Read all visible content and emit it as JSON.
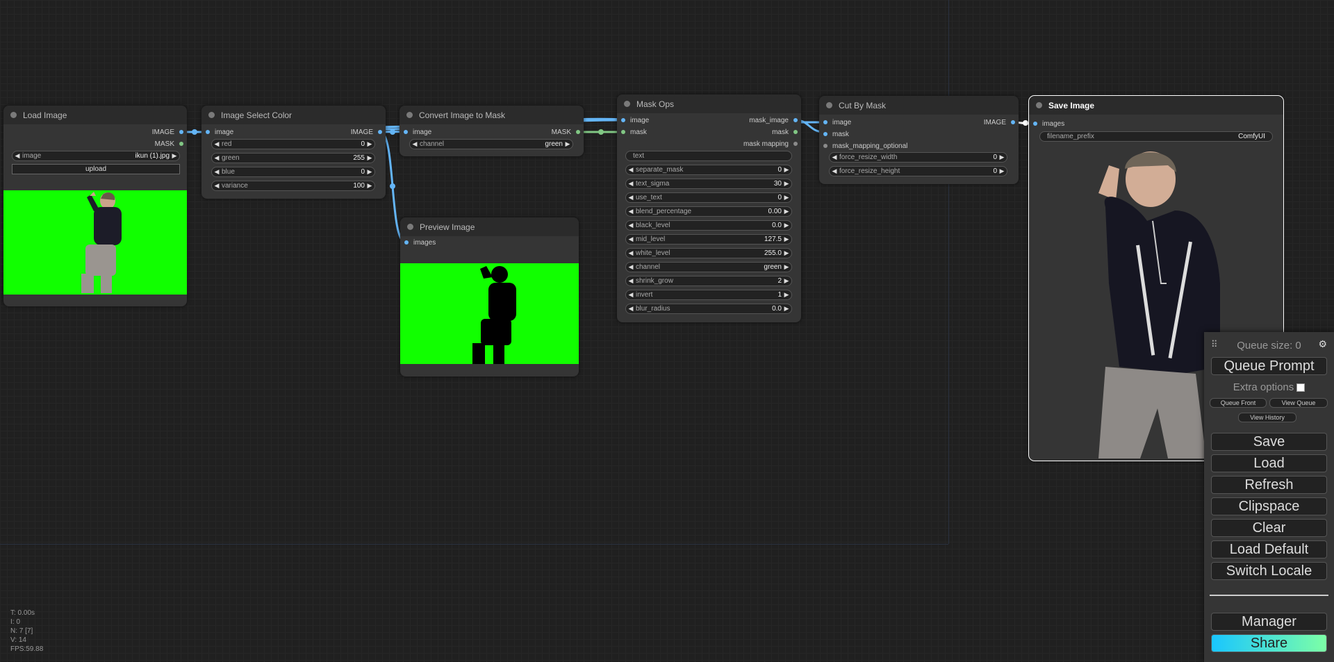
{
  "nodes": {
    "load_image": {
      "title": "Load Image",
      "outputs": [
        "IMAGE",
        "MASK"
      ],
      "image_widget": {
        "label": "image",
        "value": "ikun (1).jpg"
      },
      "upload_label": "upload"
    },
    "image_select_color": {
      "title": "Image Select Color",
      "input": "image",
      "output": "IMAGE",
      "widgets": [
        {
          "label": "red",
          "value": "0"
        },
        {
          "label": "green",
          "value": "255"
        },
        {
          "label": "blue",
          "value": "0"
        },
        {
          "label": "variance",
          "value": "100"
        }
      ]
    },
    "convert_image_to_mask": {
      "title": "Convert Image to Mask",
      "input": "image",
      "output": "MASK",
      "widget": {
        "label": "channel",
        "value": "green"
      }
    },
    "preview_image": {
      "title": "Preview Image",
      "input": "images"
    },
    "mask_ops": {
      "title": "Mask Ops",
      "inputs": [
        "image",
        "mask"
      ],
      "outputs": [
        "mask_image",
        "mask",
        "mask mapping"
      ],
      "text_placeholder": "text",
      "widgets": [
        {
          "label": "separate_mask",
          "value": "0"
        },
        {
          "label": "text_sigma",
          "value": "30"
        },
        {
          "label": "use_text",
          "value": "0"
        },
        {
          "label": "blend_percentage",
          "value": "0.00"
        },
        {
          "label": "black_level",
          "value": "0.0"
        },
        {
          "label": "mid_level",
          "value": "127.5"
        },
        {
          "label": "white_level",
          "value": "255.0"
        },
        {
          "label": "channel",
          "value": "green"
        },
        {
          "label": "shrink_grow",
          "value": "2"
        },
        {
          "label": "invert",
          "value": "1"
        },
        {
          "label": "blur_radius",
          "value": "0.0"
        }
      ]
    },
    "cut_by_mask": {
      "title": "Cut By Mask",
      "inputs": [
        "image",
        "mask",
        "mask_mapping_optional"
      ],
      "output": "IMAGE",
      "widgets": [
        {
          "label": "force_resize_width",
          "value": "0"
        },
        {
          "label": "force_resize_height",
          "value": "0"
        }
      ]
    },
    "save_image": {
      "title": "Save Image",
      "input": "images",
      "widget": {
        "label": "filename_prefix",
        "value": "ComfyUI"
      }
    }
  },
  "menu": {
    "queue_size": "Queue size: 0",
    "queue_prompt": "Queue Prompt",
    "extra_options": "Extra options",
    "queue_front": "Queue Front",
    "view_queue": "View Queue",
    "view_history": "View History",
    "save": "Save",
    "load": "Load",
    "refresh": "Refresh",
    "clipspace": "Clipspace",
    "clear": "Clear",
    "load_default": "Load Default",
    "switch_locale": "Switch Locale",
    "manager": "Manager",
    "share": "Share"
  },
  "stats": {
    "t": "T: 0.00s",
    "i": "I: 0",
    "n": "N: 7 [7]",
    "v": "V: 14",
    "fps": "FPS:59.88"
  },
  "icons": {
    "drag": "drag-handle-icon",
    "settings": "gear-icon",
    "left_arrow": "triangle-left",
    "right_arrow": "triangle-right"
  },
  "colors": {
    "image_link": "#64b5f6",
    "mask_link": "#81c784",
    "chroma_green": "#11ff00",
    "share_gradient_start": "#19c6ff",
    "share_gradient_end": "#7dffa6"
  }
}
